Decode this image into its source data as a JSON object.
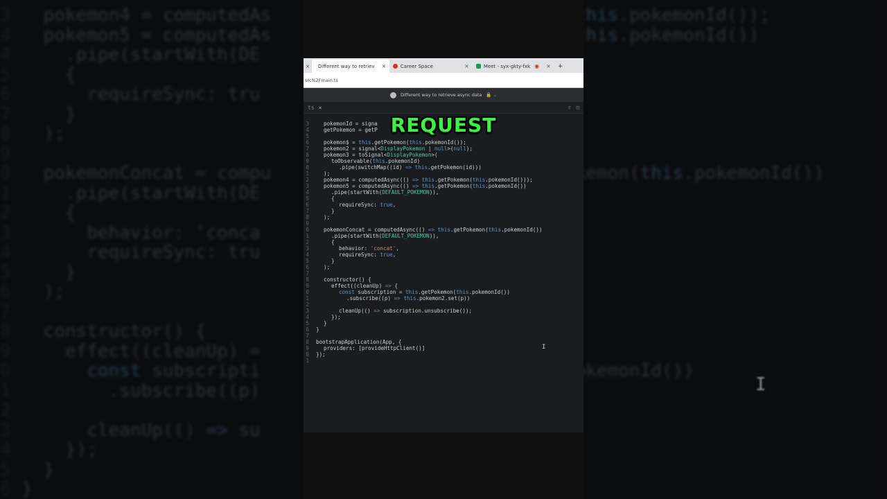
{
  "caption": "REQUEST",
  "browser": {
    "tabs": [
      {
        "label": "Different way to retriev",
        "favicon": "page-icon",
        "color": "#1a73e8",
        "active": true
      },
      {
        "label": "Career Space",
        "favicon": "career-icon",
        "color": "#d93025",
        "active": false
      },
      {
        "label": "Meet - syx-gkty-fxk",
        "favicon": "meet-icon",
        "color": "#0f9d58",
        "active": false
      }
    ],
    "new_tab": "+",
    "address": "src%2Fmain.ts",
    "window_title": "Different way to retrieve async data",
    "lock_indicator": "🔒 ⌄"
  },
  "editor": {
    "file_close": "×",
    "lines": [
      {
        "n": "3",
        "i": 1,
        "t": "pokemonId = signa"
      },
      {
        "n": "4",
        "i": 1,
        "t": "getPokemon = getP"
      },
      {
        "n": "5",
        "i": 0,
        "t": ""
      },
      {
        "n": "6",
        "i": 1,
        "t": "pokemon$ = this.getPokemon(this.pokemonId());"
      },
      {
        "n": "7",
        "i": 1,
        "t": "pokemon2 = signal<DisplayPokemon | null>(null);"
      },
      {
        "n": "8",
        "i": 1,
        "t": "pokemon3 = toSignal<DisplayPokemon>("
      },
      {
        "n": "9",
        "i": 2,
        "t": "toObservable(this.pokemonId)"
      },
      {
        "n": "0",
        "i": 3,
        "t": ".pipe(switchMap((id) => this.getPokemon(id)))"
      },
      {
        "n": "1",
        "i": 1,
        "t": ");"
      },
      {
        "n": "2",
        "i": 1,
        "t": "pokemon4 = computedAsync(() => this.getPokemon(this.pokemonId()));"
      },
      {
        "n": "3",
        "i": 1,
        "t": "pokemon5 = computedAsync(() => this.getPokemon(this.pokemonId())"
      },
      {
        "n": "4",
        "i": 2,
        "t": ".pipe(startWith(DEFAULT_POKEMON)),"
      },
      {
        "n": "5",
        "i": 2,
        "t": "{"
      },
      {
        "n": "6",
        "i": 3,
        "t": "requireSync: true,"
      },
      {
        "n": "7",
        "i": 2,
        "t": "}"
      },
      {
        "n": "8",
        "i": 1,
        "t": ");"
      },
      {
        "n": "9",
        "i": 0,
        "t": ""
      },
      {
        "n": "0",
        "i": 1,
        "t": "pokemonConcat = computedAsync(() => this.getPokemon(this.pokemonId())"
      },
      {
        "n": "1",
        "i": 2,
        "t": ".pipe(startWith(DEFAULT_POKEMON)),"
      },
      {
        "n": "2",
        "i": 2,
        "t": "{"
      },
      {
        "n": "3",
        "i": 3,
        "t": "behavior: 'concat',"
      },
      {
        "n": "4",
        "i": 3,
        "t": "requireSync: true,"
      },
      {
        "n": "5",
        "i": 2,
        "t": "}"
      },
      {
        "n": "6",
        "i": 1,
        "t": ");"
      },
      {
        "n": "7",
        "i": 0,
        "t": ""
      },
      {
        "n": "8",
        "i": 1,
        "t": "constructor() {"
      },
      {
        "n": "9",
        "i": 2,
        "t": "effect((cleanUp) => {"
      },
      {
        "n": "0",
        "i": 3,
        "t": "const subscription = this.getPokemon(this.pokemonId())"
      },
      {
        "n": "1",
        "i": 4,
        "t": ".subscribe((p) => this.pokemon2.set(p))"
      },
      {
        "n": "2",
        "i": 0,
        "t": ""
      },
      {
        "n": "3",
        "i": 3,
        "t": "cleanUp(() => subscription.unsubscribe());"
      },
      {
        "n": "4",
        "i": 2,
        "t": "});"
      },
      {
        "n": "5",
        "i": 1,
        "t": "}"
      },
      {
        "n": "6",
        "i": 0,
        "t": "}"
      },
      {
        "n": "7",
        "i": 0,
        "t": ""
      },
      {
        "n": "8",
        "i": 0,
        "t": "bootstrapApplication(App, {"
      },
      {
        "n": "9",
        "i": 1,
        "t": "providers: [provideHttpClient()]"
      },
      {
        "n": "0",
        "i": 0,
        "t": "});"
      },
      {
        "n": "1",
        "i": 0,
        "t": ""
      }
    ]
  },
  "background": {
    "lines": [
      {
        "n": "3",
        "t": "  pokemon4 = computedAs                          n(this.pokemonId());"
      },
      {
        "n": "4",
        "t": "  pokemon5 = computedAs                          n(this.pokemonId())"
      },
      {
        "n": "4",
        "t": "    .pipe(startWith(DE"
      },
      {
        "n": "5",
        "t": "    {"
      },
      {
        "n": "6",
        "t": "      requireSync: tru"
      },
      {
        "n": "7",
        "t": "    }"
      },
      {
        "n": "8",
        "t": "  );"
      },
      {
        "n": "9",
        "t": ""
      },
      {
        "n": "0",
        "t": "  pokemonConcat = compu                          Pokemon(this.pokemonId())"
      },
      {
        "n": "1",
        "t": "    .pipe(startWith(DE"
      },
      {
        "n": "2",
        "t": "    {"
      },
      {
        "n": "3",
        "t": "      behavior: 'conca"
      },
      {
        "n": "4",
        "t": "      requireSync: tru"
      },
      {
        "n": "5",
        "t": "    }"
      },
      {
        "n": "6",
        "t": "  );"
      },
      {
        "n": "7",
        "t": ""
      },
      {
        "n": "8",
        "t": "  constructor() {"
      },
      {
        "n": "9",
        "t": "    effect((cleanUp) ="
      },
      {
        "n": "0",
        "t": "      const subscripti                          s.pokemonId())"
      },
      {
        "n": "1",
        "t": "        .subscribe((p)                          )"
      },
      {
        "n": "2",
        "t": ""
      },
      {
        "n": "3",
        "t": "      cleanUp(() => su                          );"
      },
      {
        "n": "4",
        "t": "    });"
      },
      {
        "n": "5",
        "t": "  }"
      },
      {
        "n": "6",
        "t": "}"
      }
    ]
  }
}
